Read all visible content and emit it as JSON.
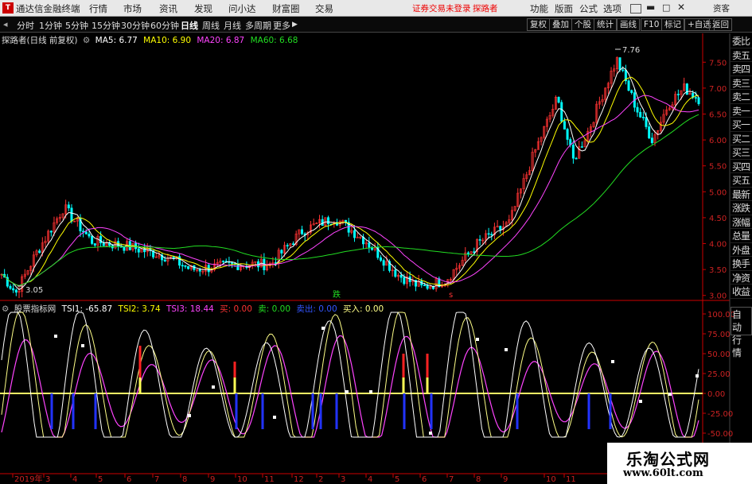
{
  "titlebar": {
    "app_name": "通达信金融终端",
    "menus": [
      "行情",
      "市场",
      "资讯",
      "发现",
      "问小达",
      "财富圈",
      "交易"
    ],
    "login_status": "证券交易未登录",
    "user": "探路者",
    "right_menus": [
      "功能",
      "版面",
      "公式",
      "选项"
    ],
    "news_btn": "资客"
  },
  "toolbar": {
    "periods": [
      "分时",
      "1分钟",
      "5分钟",
      "15分钟",
      "30分钟",
      "60分钟",
      "日线",
      "周线",
      "月线",
      "多周期",
      "更多"
    ],
    "active_period": "日线",
    "right_buttons": [
      "复权",
      "叠加",
      "个股",
      "统计",
      "画线",
      "F10",
      "标记",
      "+自选",
      "返回"
    ]
  },
  "main_chart": {
    "stock": "探路者(日线 前复权)",
    "ma_labels": [
      {
        "text": "MA5: 6.77",
        "color": "#ffffff"
      },
      {
        "text": "MA10: 6.90",
        "color": "#ffff00"
      },
      {
        "text": "MA20: 6.87",
        "color": "#ff44ff"
      },
      {
        "text": "MA60: 6.68",
        "color": "#22dd22"
      }
    ],
    "y_ticks": [
      "7.50",
      "7.00",
      "6.50",
      "6.00",
      "5.50",
      "5.00",
      "4.50",
      "4.00",
      "3.50",
      "3.00"
    ],
    "high_label": "7.76",
    "low_label": "3.05",
    "signal_labels": [
      "跌",
      "s"
    ]
  },
  "indicator": {
    "name": "股票指标网",
    "labels": [
      {
        "text": "TSI1: -65.87",
        "color": "#ffffff"
      },
      {
        "text": "TSI2: 3.74",
        "color": "#ffff00"
      },
      {
        "text": "TSI3: 18.44",
        "color": "#ff44ff"
      },
      {
        "text": "买: 0.00",
        "color": "#ff3333"
      },
      {
        "text": "卖: 0.00",
        "color": "#22dd22"
      },
      {
        "text": "卖出: 0.00",
        "color": "#3355ff"
      },
      {
        "text": "买入: 0.00",
        "color": "#ffff88"
      }
    ],
    "y_ticks": [
      "100.00",
      "75.00",
      "50.00",
      "25.00",
      "0.00",
      "-25.00",
      "-50.00"
    ]
  },
  "x_axis": {
    "labels": [
      "2019年",
      "3",
      "4",
      "5",
      "6",
      "7",
      "8",
      "9",
      "10",
      "11",
      "12",
      "2",
      "3",
      "4",
      "5",
      "6",
      "7",
      "8",
      "9",
      "10",
      "11"
    ]
  },
  "right_panel": {
    "items": [
      "委比",
      "卖五",
      "卖四",
      "卖三",
      "卖二",
      "卖一",
      "买一",
      "买二",
      "买三",
      "买四",
      "买五",
      "最新",
      "涨跌",
      "涨幅",
      "总量",
      "外盘",
      "换手",
      "净资",
      "收益"
    ],
    "boxes": [
      "自动",
      "行情"
    ]
  },
  "watermark": {
    "line1": "乐淘公式网",
    "line2": "www.60lt.com"
  },
  "colors": {
    "price_up": "#ff3333",
    "price_down": "#00ffff",
    "axis": "#cc0000",
    "ma5": "#ffffff",
    "ma10": "#ffff00",
    "ma20": "#ff44ff",
    "ma60": "#22dd22"
  }
}
